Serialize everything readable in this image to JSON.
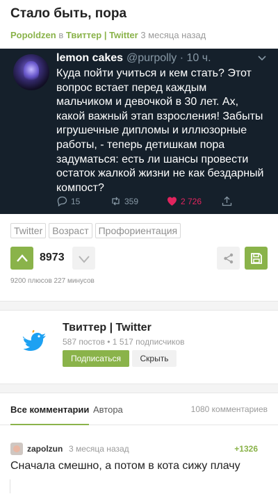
{
  "post": {
    "title": "Стало быть, пора",
    "author": "Popoldzen",
    "in_word": "в",
    "community": "Твиттер | Twitter",
    "time": "3 месяца назад"
  },
  "tweet": {
    "name": "lemon cakes",
    "handle": "@purpolly · 10 ч.",
    "text": "Куда пойти учиться и кем стать? Этот вопрос встает перед каждым мальчиком и девочкой в 30 лет. Ах, какой важный этап взросления! Забыты игрушечные дипломы и иллюзорные работы, - теперь детишкам пора задуматься: есть ли шансы провести остаток жалкой жизни не как бездарный компост?",
    "replies": "15",
    "retweets": "359",
    "likes": "2 726",
    "bg_color": "#15202b",
    "like_color": "#e0245e"
  },
  "tags": [
    "Twitter",
    "Возраст",
    "Профориентация"
  ],
  "rating": {
    "value": "8973",
    "stats": "9200 плюсов 227 минусов"
  },
  "community": {
    "name": "Твиттер | Twitter",
    "stats": "587 постов  •  1 517 подписчиков",
    "subscribe_label": "Подписаться",
    "hide_label": "Скрыть"
  },
  "comments": {
    "tab_all": "Все комментарии",
    "tab_author": "Автора",
    "count": "1080 комментариев",
    "first": {
      "user": "zapolzun",
      "time": "3 месяца назад",
      "score": "+1326",
      "text": "Сначала смешно, а потом в кота сижу плачу"
    }
  },
  "colors": {
    "accent": "#8ab34a"
  },
  "icons": {
    "vote_up": "chevron-up-icon",
    "vote_down": "chevron-down-icon",
    "share": "share-icon",
    "save": "save-icon",
    "reply": "reply-icon",
    "retweet": "retweet-icon",
    "like": "heart-icon",
    "upload": "upload-icon",
    "community": "twitter-bird-icon"
  }
}
